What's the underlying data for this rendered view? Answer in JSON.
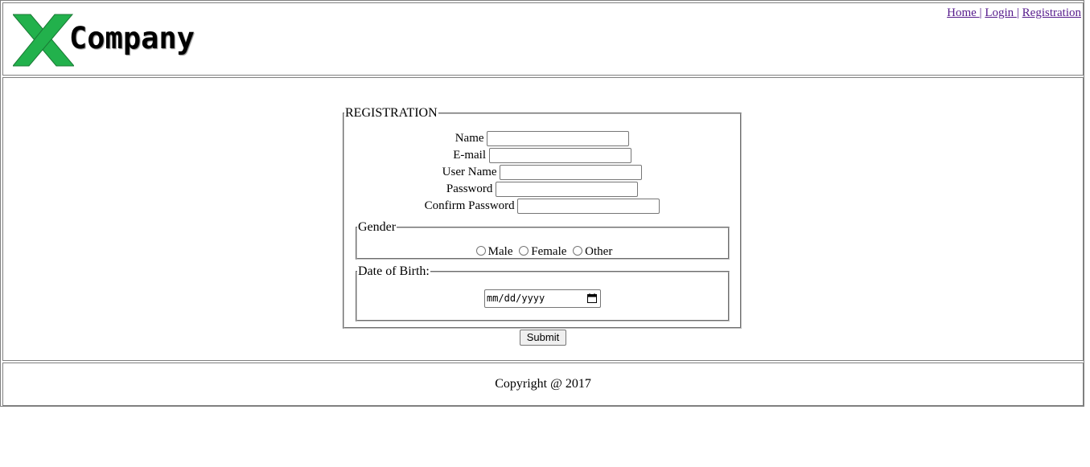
{
  "header": {
    "logo_text": "Company",
    "nav": {
      "home": "Home ",
      "login": "Login ",
      "registration": "Registration",
      "separator": "|"
    }
  },
  "registration": {
    "legend": "REGISTRATION",
    "fields": {
      "name_label": "Name",
      "email_label": "E-mail",
      "username_label": "User Name",
      "password_label": "Password",
      "confirm_label": "Confirm Password"
    },
    "gender": {
      "legend": "Gender",
      "options": [
        "Male",
        "Female",
        "Other"
      ]
    },
    "dob": {
      "legend": "Date of Birth:",
      "placeholder": "mm/dd/yyyy"
    },
    "submit_label": "Submit"
  },
  "footer": {
    "copyright": "Copyright @ 2017"
  },
  "colors": {
    "logo_green": "#22b14c",
    "link": "#551a8b",
    "border": "#808080"
  }
}
